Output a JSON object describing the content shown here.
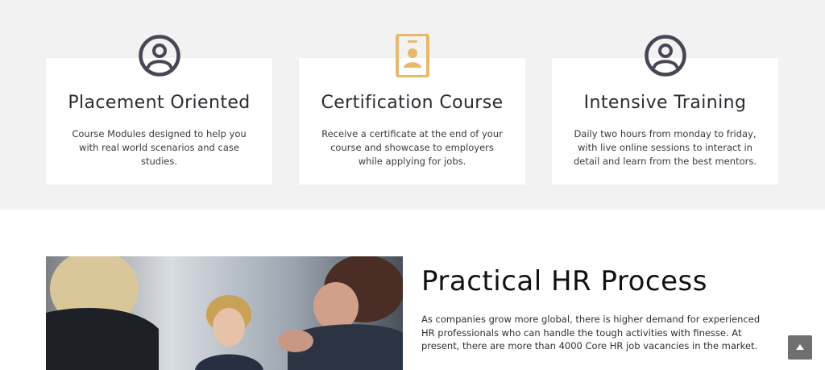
{
  "features": [
    {
      "icon": "user-circle-icon",
      "title": "Placement Oriented",
      "desc": "Course Modules designed to help you with real world scenarios and case studies."
    },
    {
      "icon": "id-badge-icon",
      "title": "Certification Course",
      "desc": "Receive a certificate at the end of your course and showcase to employers while applying for jobs."
    },
    {
      "icon": "user-circle-icon",
      "title": "Intensive Training",
      "desc": "Daily two hours from monday to friday, with live online sessions to interact in detail and learn from the best mentors."
    }
  ],
  "section": {
    "title": "Practical HR Process",
    "text": "As companies grow more global, there is higher demand for experienced HR professionals who can handle the tough activities with finesse. At present, there are more than 4000 Core HR job vacancies in the market."
  },
  "colors": {
    "icon_dark": "#4a4455",
    "icon_accent": "#e8b86a",
    "background": "#f2f2f2"
  }
}
